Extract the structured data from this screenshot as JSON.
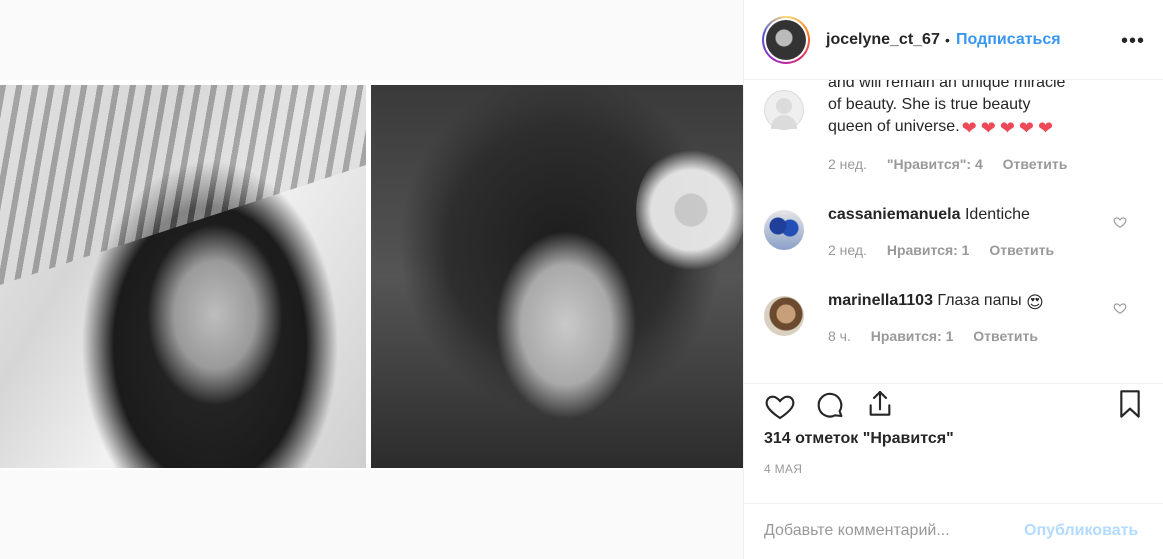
{
  "header": {
    "username": "jocelyne_ct_67",
    "separator": "•",
    "follow_label": "Подписаться",
    "more_label": "•••"
  },
  "comments": [
    {
      "partial_top_line": "and will remain an unique miracle",
      "text_line1": "of beauty. She is true beauty",
      "text_line2": "queen of universe.",
      "emoji": "❤❤❤❤❤",
      "time": "2 нед.",
      "likes": "\"Нравится\": 4",
      "reply": "Ответить"
    },
    {
      "username": "cassaniemanuela",
      "text": "Identiche",
      "time": "2 нед.",
      "likes": "Нравится: 1",
      "reply": "Ответить"
    },
    {
      "username": "marinella1103",
      "text": "Глаза папы",
      "emoji": "😍",
      "time": "8 ч.",
      "likes": "Нравится: 1",
      "reply": "Ответить"
    }
  ],
  "likes_count": "314 отметок \"Нравится\"",
  "date": "4 МАЯ",
  "add_comment": {
    "placeholder": "Добавьте комментарий...",
    "publish_label": "Опубликовать"
  },
  "colors": {
    "link": "#3897f0",
    "publish_disabled": "#b3dbff",
    "heart_red": "#ed4956",
    "muted": "#999999"
  },
  "icons": [
    "heart-icon",
    "comment-icon",
    "share-icon",
    "bookmark-icon",
    "more-icon",
    "heart-small-icon"
  ]
}
